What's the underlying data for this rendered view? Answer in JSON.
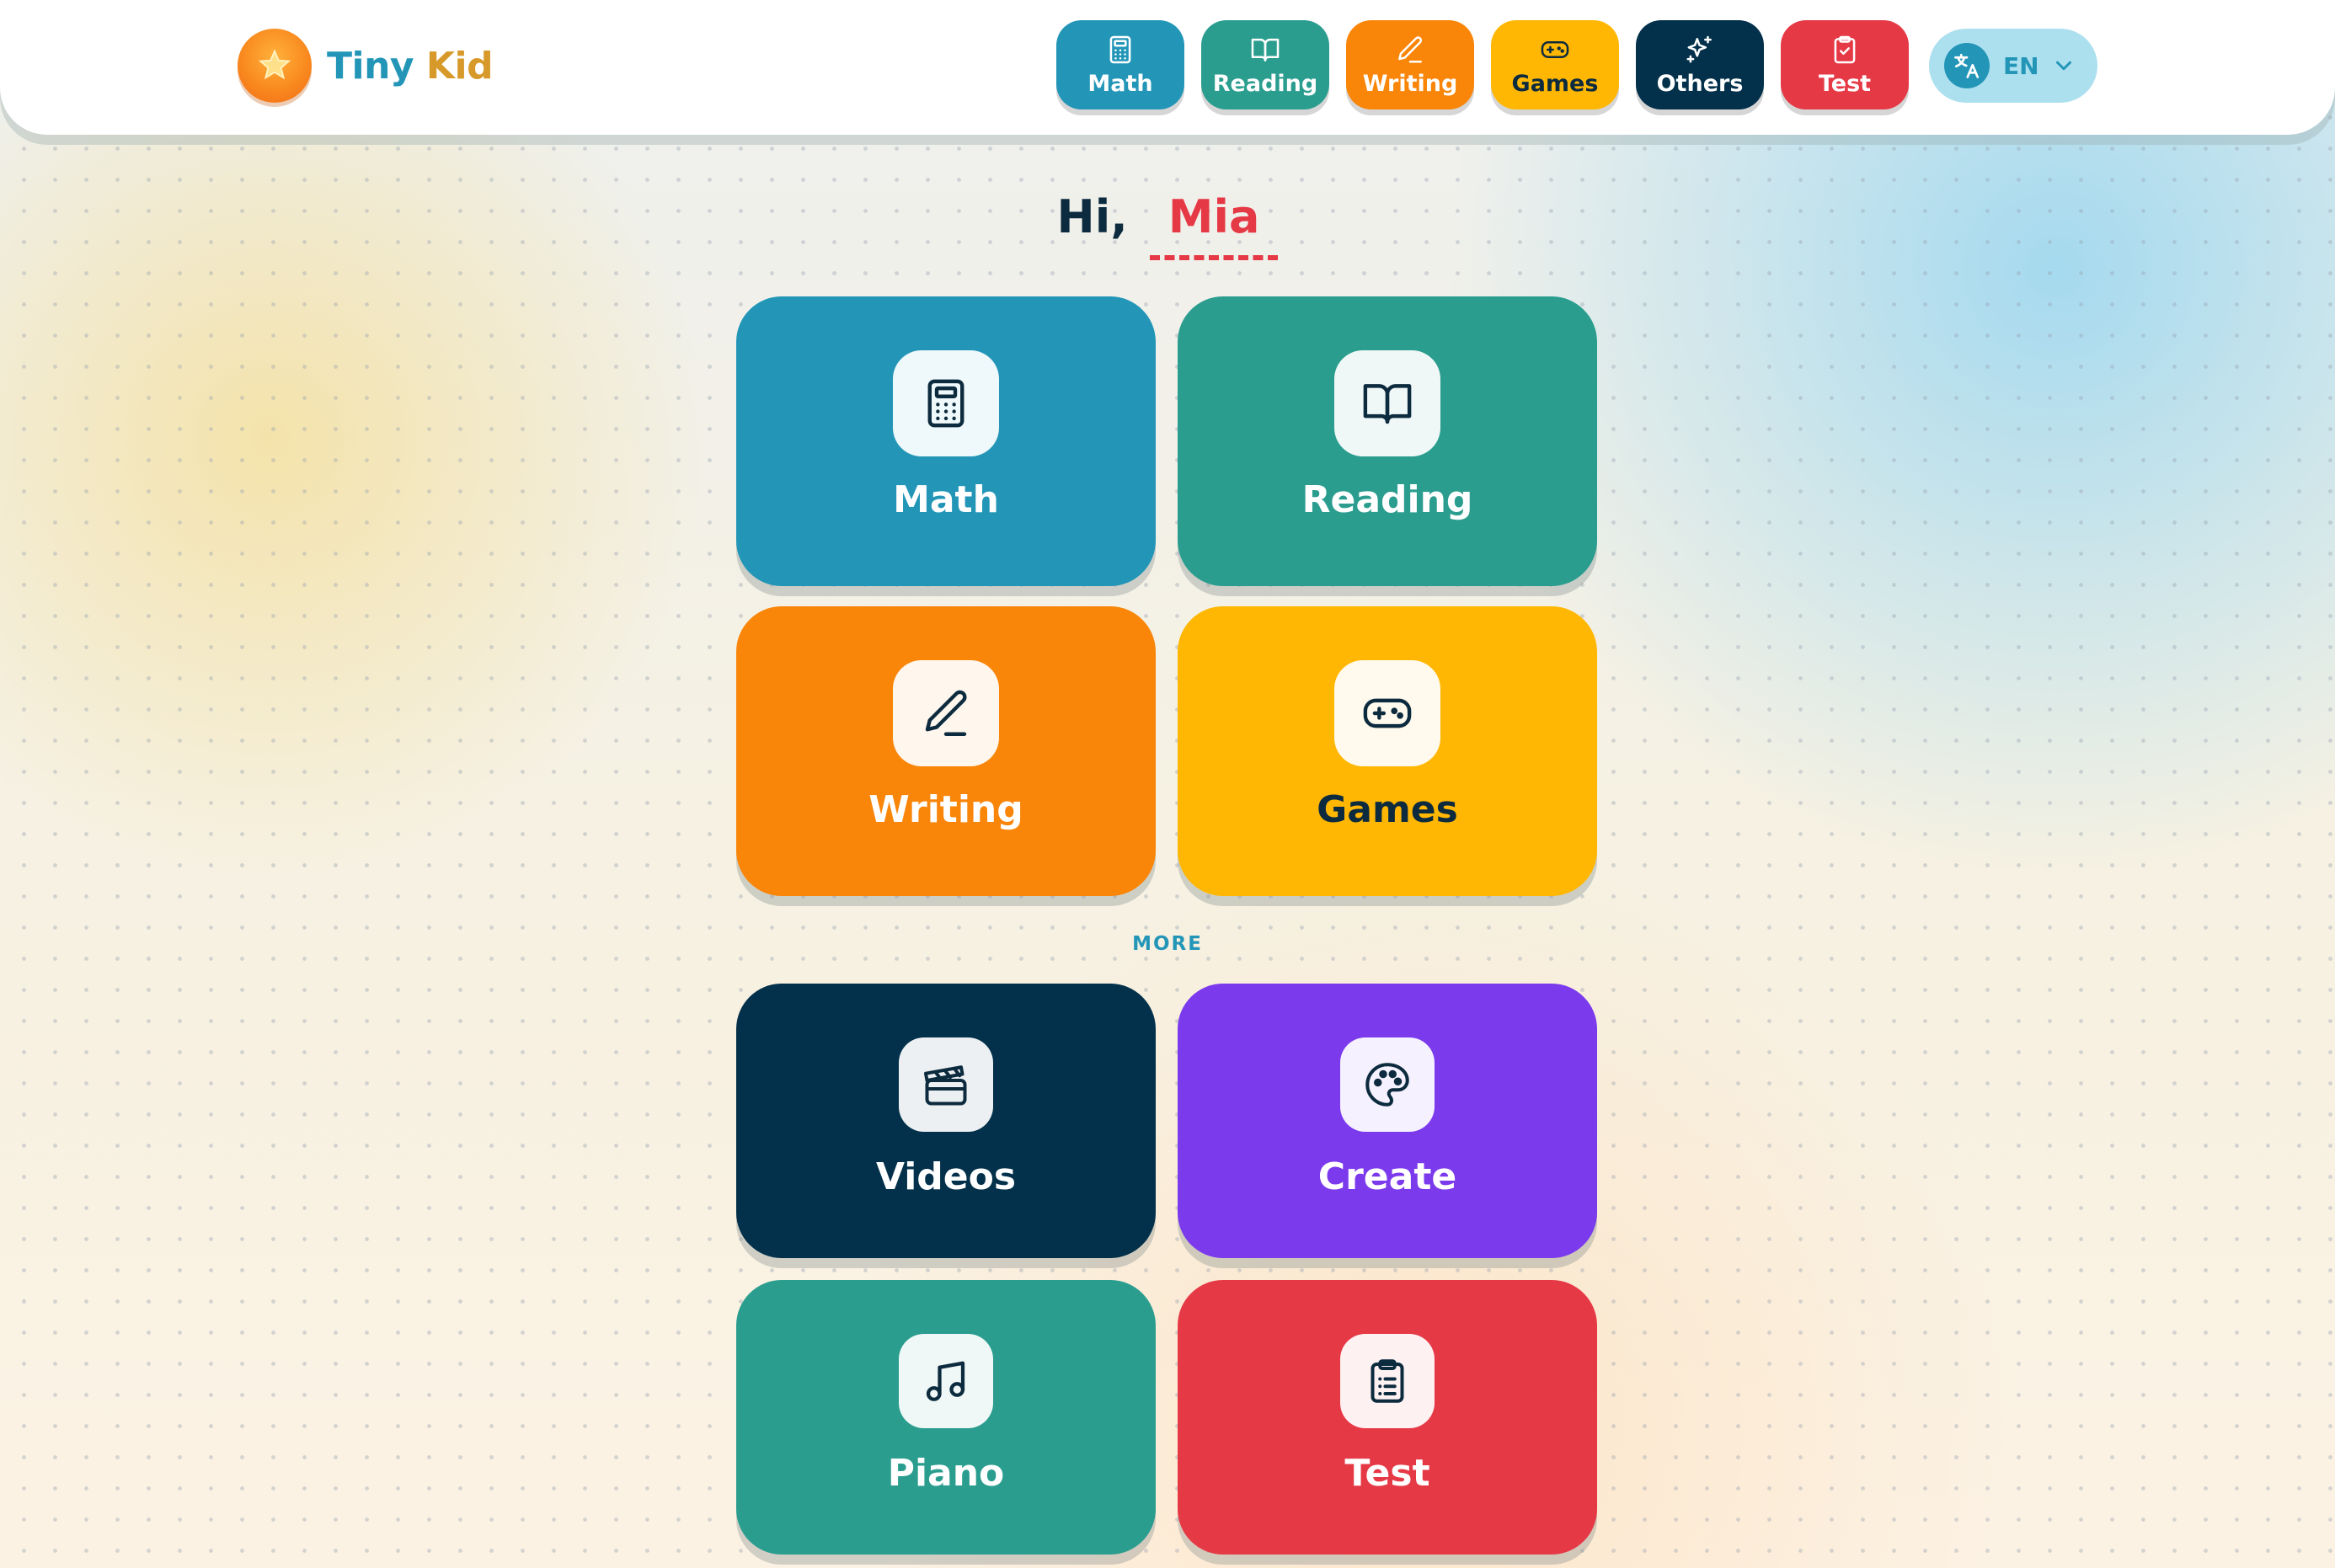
{
  "app": {
    "logo_part1": "Tiny ",
    "logo_part2": "Kid"
  },
  "nav": [
    {
      "label": "Math",
      "icon": "calculator-icon",
      "color": "#2396b8"
    },
    {
      "label": "Reading",
      "icon": "book-icon",
      "color": "#2a9d8f"
    },
    {
      "label": "Writing",
      "icon": "pencil-icon",
      "color": "#f98509"
    },
    {
      "label": "Games",
      "icon": "gamepad-icon",
      "color": "#ffb703"
    },
    {
      "label": "Others",
      "icon": "sparkles-icon",
      "color": "#03304a"
    },
    {
      "label": "Test",
      "icon": "clipboard-check-icon",
      "color": "#e63946"
    }
  ],
  "language": {
    "label": "EN",
    "icon": "translate-icon"
  },
  "greeting": {
    "prefix": "Hi,",
    "name": "Mia"
  },
  "main_cards": [
    {
      "label": "Math",
      "icon": "calculator-icon",
      "color": "#2396b8"
    },
    {
      "label": "Reading",
      "icon": "book-icon",
      "color": "#2a9d8f"
    },
    {
      "label": "Writing",
      "icon": "pencil-icon",
      "color": "#f98509"
    },
    {
      "label": "Games",
      "icon": "gamepad-icon",
      "color": "#ffb703"
    }
  ],
  "more_label": "MORE",
  "more_cards": [
    {
      "label": "Videos",
      "icon": "clapperboard-icon",
      "color": "#03304a"
    },
    {
      "label": "Create",
      "icon": "palette-icon",
      "color": "#7b3aec"
    },
    {
      "label": "Piano",
      "icon": "music-note-icon",
      "color": "#2a9d8f"
    },
    {
      "label": "Test",
      "icon": "clipboard-list-icon",
      "color": "#e63946"
    }
  ]
}
